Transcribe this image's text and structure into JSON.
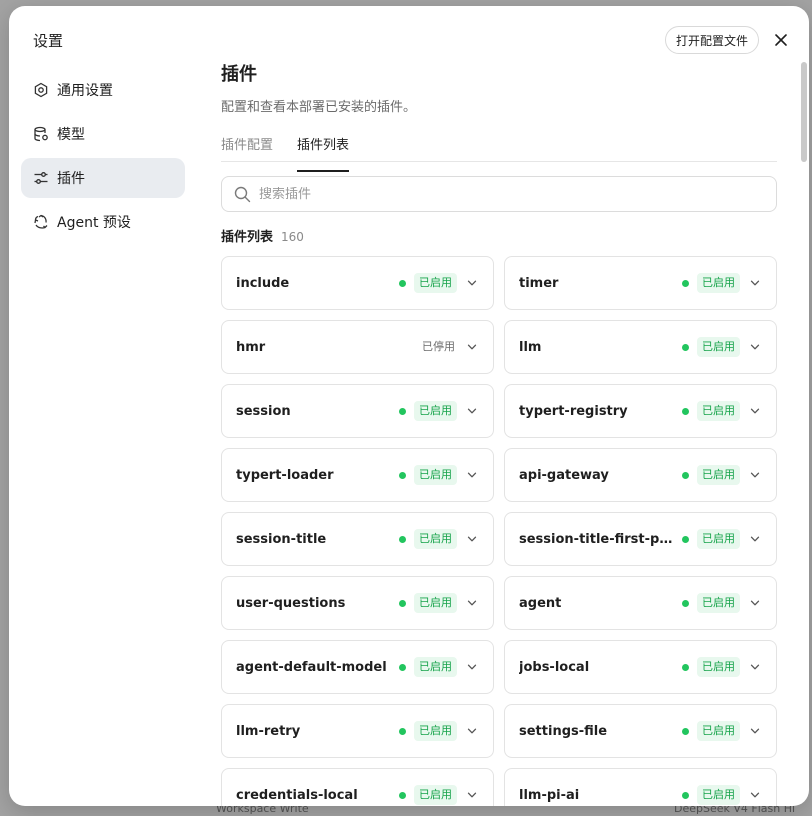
{
  "backdrop": {
    "bottom_left_text": "Workspace Write",
    "bottom_right_text": "DeepSeek V4 Flash Hi"
  },
  "sidebar": {
    "title": "设置",
    "items": [
      {
        "label": "通用设置",
        "icon": "gear-icon",
        "active": false
      },
      {
        "label": "模型",
        "icon": "database-icon",
        "active": false
      },
      {
        "label": "插件",
        "icon": "sliders-icon",
        "active": true
      },
      {
        "label": "Agent 预设",
        "icon": "recycle-icon",
        "active": false
      }
    ]
  },
  "header": {
    "open_config_label": "打开配置文件",
    "close_icon": "close-icon"
  },
  "main": {
    "title": "插件",
    "description": "配置和查看本部署已安装的插件。",
    "tabs": [
      {
        "label": "插件配置",
        "active": false
      },
      {
        "label": "插件列表",
        "active": true
      }
    ],
    "search": {
      "placeholder": "搜索插件",
      "value": ""
    },
    "list_title": "插件列表",
    "list_count": "160",
    "plugins": [
      {
        "name": "include",
        "status": "已启用",
        "enabled": true
      },
      {
        "name": "timer",
        "status": "已启用",
        "enabled": true
      },
      {
        "name": "hmr",
        "status": "已停用",
        "enabled": false
      },
      {
        "name": "llm",
        "status": "已启用",
        "enabled": true
      },
      {
        "name": "session",
        "status": "已启用",
        "enabled": true
      },
      {
        "name": "typert-registry",
        "status": "已启用",
        "enabled": true
      },
      {
        "name": "typert-loader",
        "status": "已启用",
        "enabled": true
      },
      {
        "name": "api-gateway",
        "status": "已启用",
        "enabled": true
      },
      {
        "name": "session-title",
        "status": "已启用",
        "enabled": true
      },
      {
        "name": "session-title-first-prompt",
        "status": "已启用",
        "enabled": true
      },
      {
        "name": "user-questions",
        "status": "已启用",
        "enabled": true
      },
      {
        "name": "agent",
        "status": "已启用",
        "enabled": true
      },
      {
        "name": "agent-default-model",
        "status": "已启用",
        "enabled": true
      },
      {
        "name": "jobs-local",
        "status": "已启用",
        "enabled": true
      },
      {
        "name": "llm-retry",
        "status": "已启用",
        "enabled": true
      },
      {
        "name": "settings-file",
        "status": "已启用",
        "enabled": true
      },
      {
        "name": "credentials-local",
        "status": "已启用",
        "enabled": true
      },
      {
        "name": "llm-pi-ai",
        "status": "已启用",
        "enabled": true
      }
    ]
  },
  "colors": {
    "enabled_green": "#22c55e",
    "enabled_badge_bg": "#e8f8ee",
    "active_nav_bg": "#e9ecf0"
  }
}
